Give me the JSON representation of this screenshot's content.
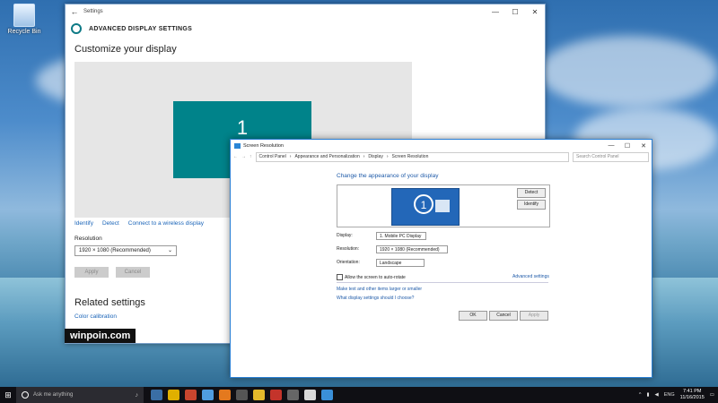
{
  "desktop": {
    "icon_label": "Recycle Bin"
  },
  "settings_window": {
    "app_title": "Settings",
    "section_title": "ADVANCED DISPLAY SETTINGS",
    "heading": "Customize your display",
    "monitor_number": "1",
    "links": [
      "Identify",
      "Detect",
      "Connect to a wireless display"
    ],
    "resolution_label": "Resolution",
    "resolution_value": "1920 × 1080 (Recommended)",
    "apply_label": "Apply",
    "cancel_label": "Cancel",
    "related_heading": "Related settings",
    "color_calibration": "Color calibration",
    "controls": [
      "—",
      "☐",
      "✕"
    ]
  },
  "watermark": "winpoin.com",
  "dialog": {
    "title": "Screen Resolution",
    "breadcrumbs": [
      "Control Panel",
      "Appearance and Personalization",
      "Display",
      "Screen Resolution"
    ],
    "search_placeholder": "Search Control Panel",
    "heading": "Change the appearance of your display",
    "monitor_number": "1",
    "detect_label": "Detect",
    "identify_label": "Identify",
    "display_label": "Display:",
    "display_value": "1. Mobile PC Display",
    "resolution_label": "Resolution:",
    "resolution_value": "1920 × 1080 (Recommended)",
    "orientation_label": "Orientation:",
    "orientation_value": "Landscape",
    "autorotate_label": "Allow the screen to auto-rotate",
    "advanced_link": "Advanced settings",
    "text_link": "Make text and other items larger or smaller",
    "which_link": "What display settings should I choose?",
    "ok_label": "OK",
    "cancel_label": "Cancel",
    "apply_label": "Apply",
    "controls": [
      "—",
      "☐",
      "✕"
    ]
  },
  "taskbar": {
    "search_placeholder": "Ask me anything",
    "language": "ENG",
    "time": "7:41 PM",
    "date": "11/16/2015",
    "app_colors": [
      "#3a6ea5",
      "#e0b000",
      "#c8452e",
      "#4f9de0",
      "#e4791e",
      "#555",
      "#e3b92b",
      "#c4342b",
      "#666",
      "#d8d8d8",
      "#3a8fd8"
    ]
  }
}
